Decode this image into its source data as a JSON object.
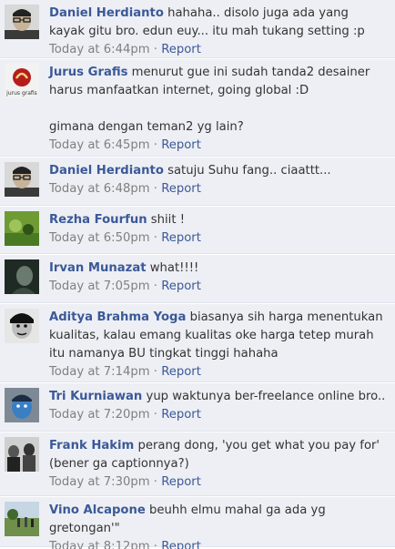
{
  "comments": [
    {
      "author": "Daniel Herdianto",
      "message": " hahaha.. disolo juga ada yang kayak gitu bro. edun euy... itu mah tukang setting :p",
      "time": "Today at 6:44pm",
      "avatar_icon": "man-portrait-glasses-icon"
    },
    {
      "author": "Jurus Grafis",
      "message": " menurut gue ini sudah tanda2 desainer harus manfaatkan internet, going global :D\n\ngimana dengan teman2 yg lain?",
      "time": "Today at 6:45pm",
      "avatar_icon": "jurus-grafis-logo-icon",
      "avatar_text": "jurus grafis"
    },
    {
      "author": "Daniel Herdianto",
      "message": " satuju Suhu fang.. ciaattt...",
      "time": "Today at 6:48pm",
      "avatar_icon": "man-portrait-glasses-icon"
    },
    {
      "author": "Rezha Fourfun",
      "message": " shiit !",
      "time": "Today at 6:50pm",
      "avatar_icon": "green-photo-icon"
    },
    {
      "author": "Irvan Munazat",
      "message": " what!!!!",
      "time": "Today at 7:05pm",
      "avatar_icon": "dark-portrait-icon"
    },
    {
      "author": "Aditya Brahma Yoga",
      "message": " biasanya sih harga menentukan kualitas, kalau emang kualitas oke harga tetep murah itu namanya BU tingkat tinggi hahaha",
      "time": "Today at 7:14pm",
      "avatar_icon": "bw-face-icon"
    },
    {
      "author": "Tri Kurniawan",
      "message": " yup waktunya ber-freelance online bro..",
      "time": "Today at 7:20pm",
      "avatar_icon": "blue-face-icon"
    },
    {
      "author": "Frank Hakim",
      "message": " perang dong, 'you get what you pay for' (bener ga captionnya?)",
      "time": "Today at 7:30pm",
      "avatar_icon": "bw-group-photo-icon"
    },
    {
      "author": "Vino Alcapone",
      "message": " beuhh elmu mahal ga ada yg gretongan'\"",
      "time": "Today at 8:12pm",
      "avatar_icon": "outdoor-photo-icon"
    }
  ],
  "meta": {
    "separator": " · ",
    "report_label": "Report"
  },
  "colors": {
    "link": "#3b5998",
    "comment_bg": "#edeff4",
    "timestamp": "#808080"
  }
}
